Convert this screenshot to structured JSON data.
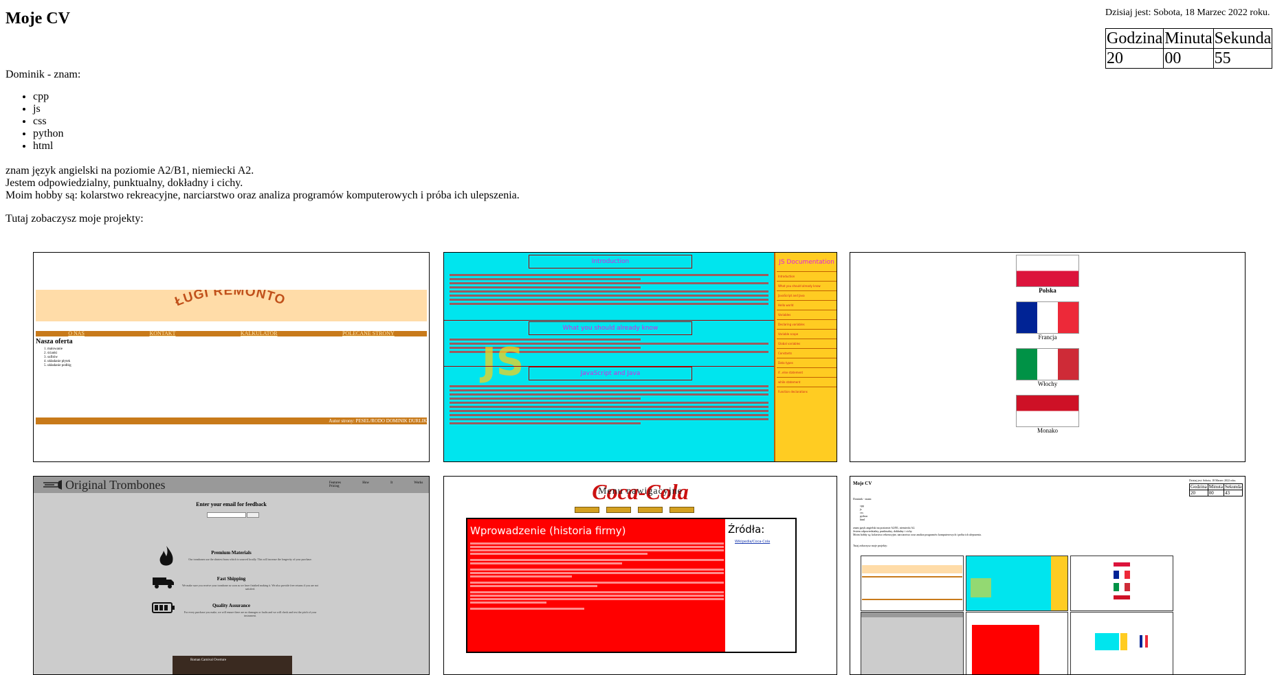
{
  "header": {
    "title": "Moje CV",
    "date_line": "Dzisiaj jest: Sobota, 18 Marzec 2022 roku."
  },
  "clock": {
    "headers": [
      "Godzina",
      "Minuta",
      "Sekunda"
    ],
    "values": [
      "20",
      "00",
      "55"
    ]
  },
  "intro": "Dominik - znam:",
  "skills": [
    "cpp",
    "js",
    "css",
    "python",
    "html"
  ],
  "about": [
    "znam język angielski na poziomie A2/B1, niemiecki A2.",
    "Jestem odpowiedzialny, punktualny, dokładny i cichy.",
    "Moim hobby są: kolarstwo rekreacyjne, narciarstwo oraz analiza programów komputerowych i próba ich ulepszenia."
  ],
  "projects_intro": "Tutaj zobaczysz moje projekty:",
  "projects": {
    "remont": {
      "logo": "USŁUGI REMONTOWE",
      "nav": [
        "O NAS",
        "KONTAKT",
        "KALKULATOR",
        "POLECANE STRONY"
      ],
      "heading": "Nasza oferta",
      "list": [
        "malowanie",
        "ścianki",
        "sufitów",
        "układanie płytek",
        "układanie podłóg"
      ],
      "footer": "Autor strony: PESEL/RODO DOMINIK DURLIK"
    },
    "js": {
      "sections": [
        "Introduction",
        "What you should already know",
        "JavaScript and Java"
      ],
      "logo": "JS",
      "side_title": "JS Documentation",
      "side_items": [
        "Introduction",
        "What you should already know",
        "JavaScript and Java",
        "Hello world",
        "Variables",
        "Declaring variables",
        "Variable scope",
        "Global variables",
        "Constants",
        "Data types",
        "if...else statement",
        "while statement",
        "Function declarations"
      ]
    },
    "flags": {
      "items": [
        {
          "label": "Polska",
          "colors": [
            "#ffffff",
            "#dc143c"
          ],
          "dir": "h"
        },
        {
          "label": "Francja",
          "colors": [
            "#002395",
            "#ffffff",
            "#ed2939"
          ],
          "dir": "v"
        },
        {
          "label": "Włochy",
          "colors": [
            "#009246",
            "#ffffff",
            "#ce2b37"
          ],
          "dir": "v"
        },
        {
          "label": "Monako",
          "colors": [
            "#ce1126",
            "#ffffff"
          ],
          "dir": "h"
        }
      ]
    },
    "trombones": {
      "logo": "Original Trombones",
      "nav": [
        "Features",
        "How It Works",
        "Pricing"
      ],
      "email_heading": "Enter your email for feedback",
      "features": [
        {
          "title": "Premium Materials",
          "text": "Our trombones use the shiniest brass which is sourced locally. This will increase the longevity of your purchase."
        },
        {
          "title": "Fast Shipping",
          "text": "We make sure you receive your trombone as soon as we have finished making it. We also provide free returns if you are not satisfied."
        },
        {
          "title": "Quality Assurance",
          "text": "For every purchase you make, we will ensure there are no damages or faults and we will check and test the pitch of your instrument."
        }
      ],
      "video_title": "Roman Carnival Overture"
    },
    "coca": {
      "logo": "Coca-Cola",
      "menu_title": "Menu nawigacyjne",
      "heading": "Wprowadzenie (historia firmy)",
      "sources_heading": "Źródła:",
      "source_link": "Wikipedia/Coca-Cola"
    },
    "cv": {
      "title": "Moje CV",
      "clock_headers": [
        "Godzina",
        "Minuta",
        "Sekunda"
      ],
      "clock_values": [
        "20",
        "00",
        "43"
      ]
    }
  }
}
